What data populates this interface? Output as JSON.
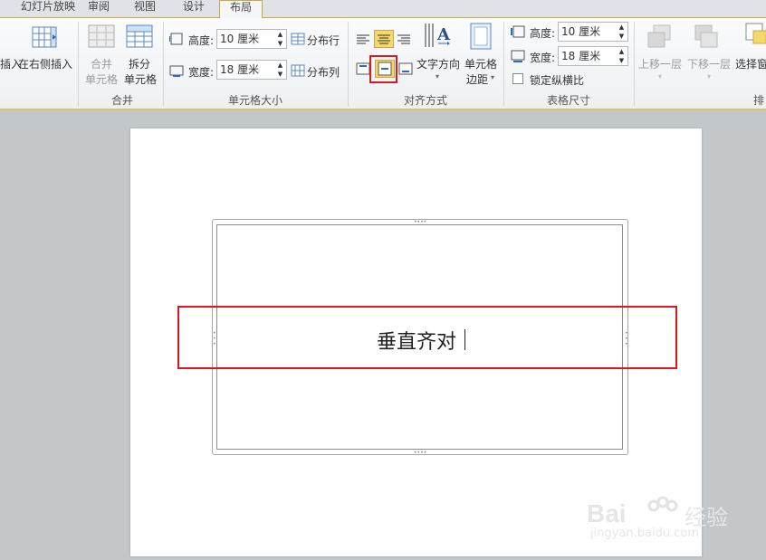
{
  "tabs": [
    {
      "label": "幻灯片放映"
    },
    {
      "label": "审阅"
    },
    {
      "label": "视图"
    },
    {
      "label": "设计"
    },
    {
      "label": "布局",
      "active": true
    }
  ],
  "ribbon": {
    "insert": {
      "insert_label": "插入",
      "insert_right_label": "在右侧插入"
    },
    "merge": {
      "merge_cells": [
        "合并",
        "单元格"
      ],
      "split_cells": [
        "拆分",
        "单元格"
      ],
      "group_label": "合并"
    },
    "cell_size": {
      "height_label": "高度:",
      "height_value": "10 厘米",
      "width_label": "宽度:",
      "width_value": "18 厘米",
      "distribute_rows": "分布行",
      "distribute_cols": "分布列",
      "group_label": "单元格大小"
    },
    "alignment": {
      "text_direction": "文字方向",
      "cell_margins": [
        "单元格",
        "边距"
      ],
      "group_label": "对齐方式"
    },
    "table_size": {
      "height_label": "高度:",
      "height_value": "10 厘米",
      "width_label": "宽度:",
      "width_value": "18 厘米",
      "lock_ratio": "锁定纵横比",
      "group_label": "表格尺寸"
    },
    "arrange": {
      "bring_forward": "上移一层",
      "send_backward": "下移一层",
      "selection_pane": "选择窗",
      "group_label": "排"
    }
  },
  "slide": {
    "cell_text": "垂直齐对"
  },
  "watermark": {
    "brand": "Bai",
    "brand_tail": "经验",
    "url": "jingyan.baidu.com"
  },
  "colors": {
    "highlight_red": "#d61a22",
    "active_gold": "#f5d86a",
    "ribbon_border": "#d9c36b"
  }
}
